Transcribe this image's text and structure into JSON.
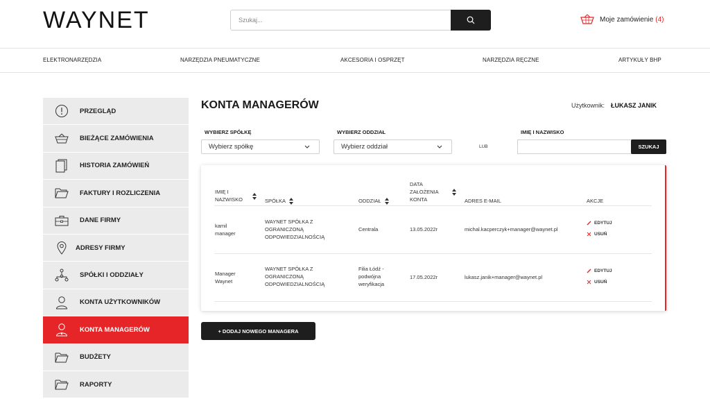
{
  "header": {
    "logo": "WAYNET",
    "search_placeholder": "Szukaj...",
    "order_label": "Moje zamówienie",
    "order_count": "(4)"
  },
  "nav": [
    "ELEKTRONARZĘDZIA",
    "NARZĘDZIA PNEUMATYCZNE",
    "AKCESORIA I OSPRZĘT",
    "NARZĘDZIA RĘCZNE",
    "ARTYKUŁY BHP"
  ],
  "sidebar": {
    "items": [
      {
        "label": "PRZEGLĄD",
        "icon": "alert-circle-icon"
      },
      {
        "label": "BIEŻĄCE ZAMÓWIENIA",
        "icon": "basket-icon"
      },
      {
        "label": "HISTORIA ZAMÓWIEŃ",
        "icon": "documents-icon"
      },
      {
        "label": "FAKTURY I ROZLICZENIA",
        "icon": "folder-icon"
      },
      {
        "label": "DANE FIRMY",
        "icon": "briefcase-icon"
      },
      {
        "label": "ADRESY FIRMY",
        "icon": "location-pin-icon"
      },
      {
        "label": "SPÓŁKI I ODDZIAŁY",
        "icon": "hierarchy-icon"
      },
      {
        "label": "KONTA UŻYTKOWNIKÓW",
        "icon": "user-icon"
      },
      {
        "label": "KONTA MANAGERÓW",
        "icon": "manager-icon"
      },
      {
        "label": "BUDŻETY",
        "icon": "folder-icon"
      },
      {
        "label": "RAPORTY",
        "icon": "folder-icon"
      }
    ],
    "active_index": 8
  },
  "main": {
    "title": "KONTA MANAGERÓW",
    "user_label": "Użytkownik:",
    "user_name": "ŁUKASZ JANIK"
  },
  "filters": {
    "company_label": "WYBIERZ SPÓŁKĘ",
    "company_value": "Wybierz spółkę",
    "branch_label": "WYBIERZ ODDZIAŁ",
    "branch_value": "Wybierz oddział",
    "or_label": "LUB",
    "name_label": "IMIĘ I NAZWISKO",
    "name_value": "",
    "search_button": "SZUKAJ"
  },
  "table": {
    "headers": {
      "name": [
        "IMIĘ I",
        "NAZWISKO"
      ],
      "company": "SPÓŁKA",
      "branch": "ODDZIAŁ",
      "date": [
        "DATA",
        "ZAŁOŻENIA",
        "KONTA"
      ],
      "email": "ADRES E-MAIL",
      "actions": "AKCJE"
    },
    "rows": [
      {
        "name": [
          "kamil",
          "manager"
        ],
        "company": [
          "WAYNET SPÓŁKA Z",
          "OGRANICZONĄ",
          "ODPOWIEDZIALNOŚCIĄ"
        ],
        "branch": [
          "Centrala"
        ],
        "date": "13.05.2022r",
        "email": "michal.kacperczyk+manager@waynet.pl",
        "edit": "EDYTUJ",
        "delete": "USUŃ"
      },
      {
        "name": [
          "Manager",
          "Waynet"
        ],
        "company": [
          "WAYNET SPÓŁKA Z",
          "OGRANICZONĄ",
          "ODPOWIEDZIALNOŚCIĄ"
        ],
        "branch": [
          "Filia Łódź -",
          "podwójna",
          "weryfikacja"
        ],
        "date": "17.05.2022r",
        "email": "lukasz.janik+manager@waynet.pl",
        "edit": "EDYTUJ",
        "delete": "USUŃ"
      }
    ]
  },
  "add_button": "+ DODAJ NOWEGO MANAGERA",
  "colors": {
    "accent": "#e52528",
    "dark": "#1e1e1e",
    "sidebar_bg": "#ebebeb"
  }
}
